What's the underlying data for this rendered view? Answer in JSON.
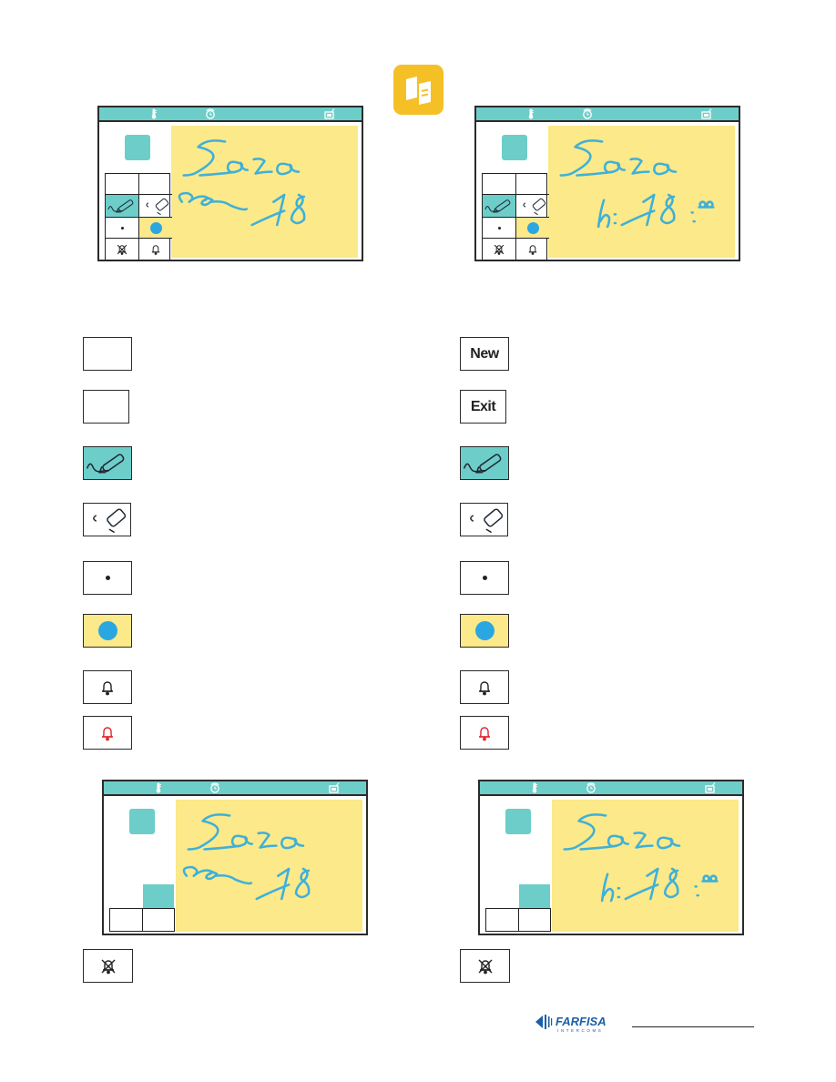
{
  "header": {
    "app_icon": "notes-icon",
    "app_icon_color": "#f5c026"
  },
  "colors": {
    "teal": "#6dcdc9",
    "note_yellow": "#fbe98a",
    "ink_blue": "#2aa7e1",
    "bell_red": "#e2232a",
    "border": "#2b2b2b"
  },
  "screens": {
    "top_left": {
      "status_icons": [
        "thermometer-icon",
        "alarm-clock-icon",
        "tv-message-icon"
      ],
      "note_line1": "Sara",
      "note_line2": "ore 18",
      "toolbar": [
        "",
        "",
        "pen-icon",
        "eraser-icon",
        "small-dot-icon",
        "big-dot-icon",
        "bell-muted-icon",
        "bell-icon"
      ]
    },
    "top_right": {
      "status_icons": [
        "thermometer-icon",
        "alarm-clock-icon",
        "tv-message-icon"
      ],
      "note_line1": "Sara",
      "note_line2": "h: 18:00",
      "toolbar": [
        "",
        "",
        "pen-icon",
        "eraser-icon",
        "small-dot-icon",
        "big-dot-icon",
        "bell-muted-icon",
        "bell-icon"
      ]
    },
    "bottom_left": {
      "status_icons": [
        "thermometer-icon",
        "alarm-clock-icon",
        "tv-message-icon"
      ],
      "note_line1": "Sara",
      "note_line2": "ore 18"
    },
    "bottom_right": {
      "status_icons": [
        "thermometer-icon",
        "alarm-clock-icon",
        "tv-message-icon"
      ],
      "note_line1": "Sara",
      "note_line2": "h: 18:00"
    }
  },
  "legend": {
    "left": [
      {
        "icon": "blank",
        "label": ""
      },
      {
        "icon": "blank",
        "label": ""
      },
      {
        "icon": "pen-icon",
        "label": ""
      },
      {
        "icon": "eraser-icon",
        "label": ""
      },
      {
        "icon": "small-dot-icon",
        "label": ""
      },
      {
        "icon": "big-dot-icon",
        "label": ""
      },
      {
        "icon": "bell-icon",
        "label": ""
      },
      {
        "icon": "bell-red-icon",
        "label": ""
      },
      {
        "icon": "bell-muted-icon",
        "label": ""
      }
    ],
    "right": [
      {
        "icon": "text",
        "label": "New"
      },
      {
        "icon": "text",
        "label": "Exit"
      },
      {
        "icon": "pen-icon",
        "label": ""
      },
      {
        "icon": "eraser-icon",
        "label": ""
      },
      {
        "icon": "small-dot-icon",
        "label": ""
      },
      {
        "icon": "big-dot-icon",
        "label": ""
      },
      {
        "icon": "bell-icon",
        "label": ""
      },
      {
        "icon": "bell-red-icon",
        "label": ""
      },
      {
        "icon": "bell-muted-icon",
        "label": ""
      }
    ]
  },
  "footer": {
    "brand": "FARFISA",
    "brand_sub": "INTERCOMS"
  }
}
